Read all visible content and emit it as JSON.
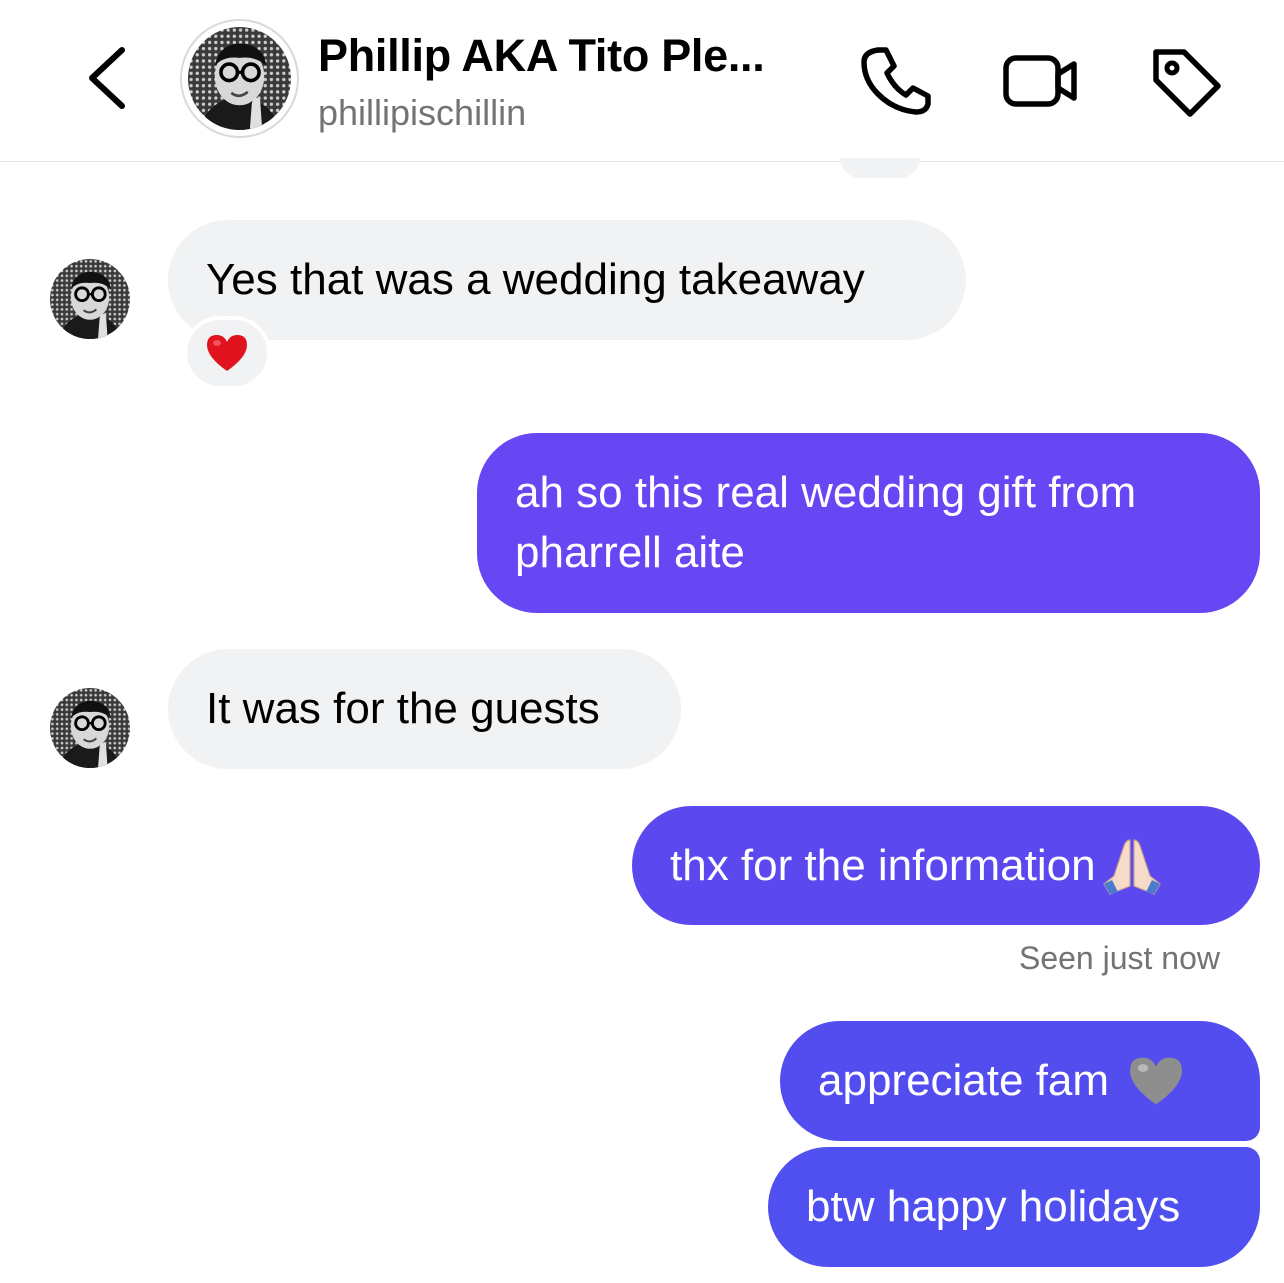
{
  "header": {
    "contact_name": "Phillip AKA Tito Ple...",
    "contact_handle": "phillipischillin",
    "icons": [
      "chevron-left-icon",
      "phone-icon",
      "video-camera-icon",
      "tag-icon"
    ]
  },
  "messages": [
    {
      "direction": "incoming",
      "text": "Yes that was a wedding takeaway",
      "reaction": "❤️"
    },
    {
      "direction": "outgoing",
      "text": "ah so this real wedding gift from pharrell aite"
    },
    {
      "direction": "incoming",
      "text": "It was for the guests"
    },
    {
      "direction": "outgoing",
      "text": "thx for the information",
      "emoji": "🙏🏻"
    },
    {
      "direction": "outgoing",
      "text": "appreciate fam",
      "emoji": "🩶"
    },
    {
      "direction": "outgoing",
      "text": "btw happy holidays"
    }
  ],
  "seen_status": "Seen just now",
  "colors": {
    "incoming_bubble": "#f1f2f4",
    "outgoing_top": "#6746f3",
    "outgoing_bottom": "#4f50ef",
    "secondary_text": "#737373"
  }
}
